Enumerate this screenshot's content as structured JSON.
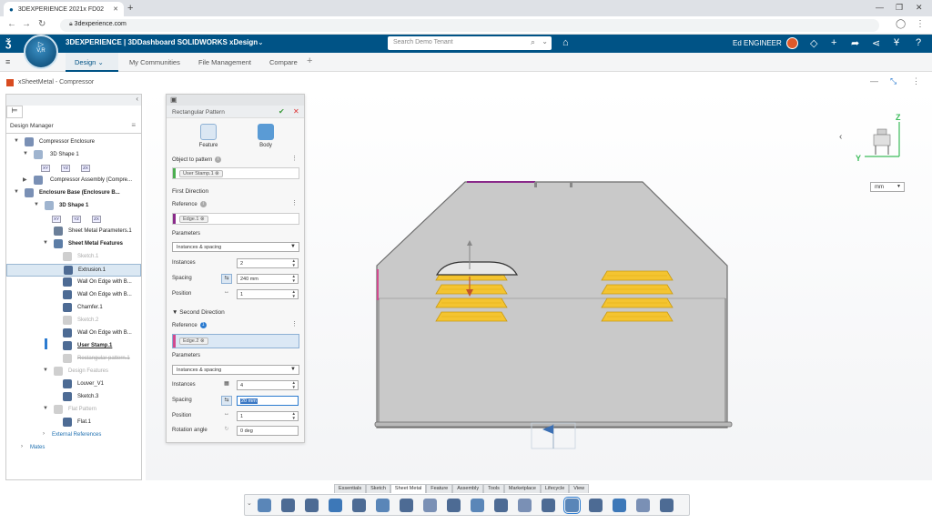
{
  "browser": {
    "tab_title": "3DEXPERIENCE 2021x FD02",
    "address": "3dexperience.com",
    "new_tab": "+",
    "minimize": "—",
    "restore": "❐",
    "close": "✕"
  },
  "topbar": {
    "app_name": "3DEXPERIENCE | 3DDashboard  SOLIDWORKS xDesign",
    "search_placeholder": "Search Demo Tenant",
    "user_name": "Ed ENGINEER",
    "compass_label": "V,R"
  },
  "tabs": {
    "design": "Design",
    "communities": "My Communities",
    "file_management": "File Management",
    "compare": "Compare",
    "add": "+"
  },
  "document": {
    "title": "xSheetMetal - Compressor"
  },
  "design_manager": {
    "title": "Design Manager",
    "items": [
      {
        "label": "Compressor Enclosure"
      },
      {
        "label": "3D Shape 1"
      },
      {
        "label": "Compressor Assembly  (Compre..."
      },
      {
        "label": "Enclosure Base (Enclosure B..."
      },
      {
        "label": "3D Shape 1"
      },
      {
        "label": "Sheet Metal Parameters.1"
      },
      {
        "label": "Sheet Metal Features"
      },
      {
        "label": "Sketch.1"
      },
      {
        "label": "Extrusion.1"
      },
      {
        "label": "Wall On Edge with B..."
      },
      {
        "label": "Wall On Edge with B..."
      },
      {
        "label": "Chamfer.1"
      },
      {
        "label": "Sketch.2"
      },
      {
        "label": "Wall On Edge with B..."
      },
      {
        "label": "User Stamp.1"
      },
      {
        "label": "Rectangular pattern.1"
      },
      {
        "label": "Design Features"
      },
      {
        "label": "Louver_V1"
      },
      {
        "label": "Sketch.3"
      },
      {
        "label": "Flat Pattern"
      },
      {
        "label": "Flat.1"
      },
      {
        "label": "External References"
      },
      {
        "label": "Mates"
      }
    ],
    "mini_icons": [
      "XY",
      "YZ",
      "ZX"
    ]
  },
  "pattern_panel": {
    "title": "Rectangular Pattern",
    "type_feature": "Feature",
    "type_body": "Body",
    "object_label": "Object to pattern",
    "object_chip": "User Stamp.1",
    "first_direction": "First Direction",
    "reference_label": "Reference",
    "ref1_chip": "Edge.1",
    "parameters_label": "Parameters",
    "param_mode": "Instances & spacing",
    "instances_label": "Instances",
    "spacing_label": "Spacing",
    "position_label": "Position",
    "first": {
      "instances": "2",
      "spacing": "240 mm",
      "position": "1"
    },
    "second_direction": "Second Direction",
    "ref2_chip": "Edge.2",
    "second": {
      "instances": "4",
      "spacing": "20 mm",
      "position": "1"
    },
    "rotation_label": "Rotation angle",
    "rotation_value": "0 deg",
    "info_count": "1"
  },
  "viewport": {
    "units": "mm",
    "triad_z": "Z",
    "triad_y": "Y"
  },
  "category_tabs": [
    "Essentials",
    "Sketch",
    "Sheet Metal",
    "Feature",
    "Assembly",
    "Tools",
    "Marketplace",
    "Lifecycle",
    "View"
  ],
  "colors": {
    "brand": "#005386",
    "louver": "#f4c430",
    "accent": "#2b7bd0"
  }
}
